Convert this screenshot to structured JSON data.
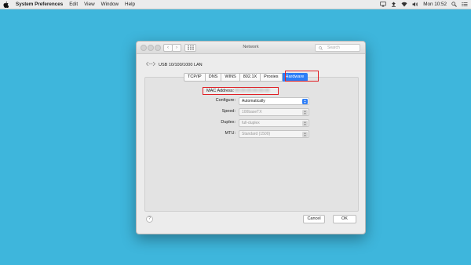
{
  "menubar": {
    "apple_icon": "apple-logo-icon",
    "app_name": "System Preferences",
    "items": [
      "Edit",
      "View",
      "Window",
      "Help"
    ],
    "clock": "Mon 10:52",
    "status_icons": [
      "cast-icon",
      "upload-icon",
      "wifi-icon",
      "volume-icon",
      "search-icon",
      "list-icon"
    ]
  },
  "window": {
    "title": "Network",
    "search_placeholder": "Search",
    "interface_name": "USB 10/100/1000 LAN",
    "tabs": [
      "TCP/IP",
      "DNS",
      "WINS",
      "802.1X",
      "Proxies",
      "Hardware"
    ],
    "selected_tab": "Hardware",
    "mac_label": "MAC Address:",
    "mac_value": "00:00:00:00:00:00",
    "fields": {
      "configure": {
        "label": "Configure:",
        "value": "Automatically"
      },
      "speed": {
        "label": "Speed:",
        "value": "100baseTX"
      },
      "duplex": {
        "label": "Duplex:",
        "value": "full-duplex"
      },
      "mtu": {
        "label": "MTU:",
        "value": "Standard (1500)"
      }
    },
    "help_label": "?",
    "cancel_label": "Cancel",
    "ok_label": "OK"
  },
  "colors": {
    "desktop": "#3eb6dc",
    "accent": "#2d7df6",
    "highlight": "#e01f25"
  }
}
